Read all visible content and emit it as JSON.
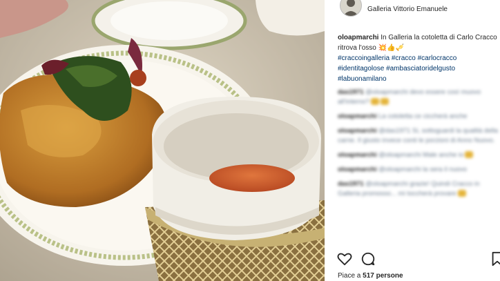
{
  "post": {
    "location": "Galleria Vittorio Emanuele",
    "caption_user": "oloapmarchi",
    "caption_text": "In Galleria la cotoletta di Carlo Cracco ritrova l'osso",
    "hashtags": [
      "#craccoingalleria",
      "#cracco",
      "#carlocracco",
      "#identitagolose",
      "#ambasciatoridelgusto",
      "#labuonamilano"
    ]
  },
  "comments": [
    {
      "user": "das1971",
      "text": "@oloapmarchi devo essere così muovo all'interno?"
    },
    {
      "user": "oloapmarchi",
      "text": "La cotoletta ce ciccherà anche"
    },
    {
      "user": "oloapmarchi",
      "text": "@das1971 Si, sottoguardi la qualità della carne. Il giusto invece conti le porzioni di Anno Nuovo."
    },
    {
      "user": "oloapmarchi",
      "text": "@oloapmarchi Male anche io"
    },
    {
      "user": "oloapmarchi",
      "text": "@oloapmarchi la sera il nuovo"
    },
    {
      "user": "das1971",
      "text": "@oloapmarchi grazie! Quindi Cracco in Galleria promosso... mi toccherà provare"
    }
  ],
  "likes": {
    "prefix": "Piace a",
    "count": "517 persone"
  },
  "icons": [
    "avatar",
    "heart-icon",
    "comment-icon",
    "bookmark-icon"
  ]
}
